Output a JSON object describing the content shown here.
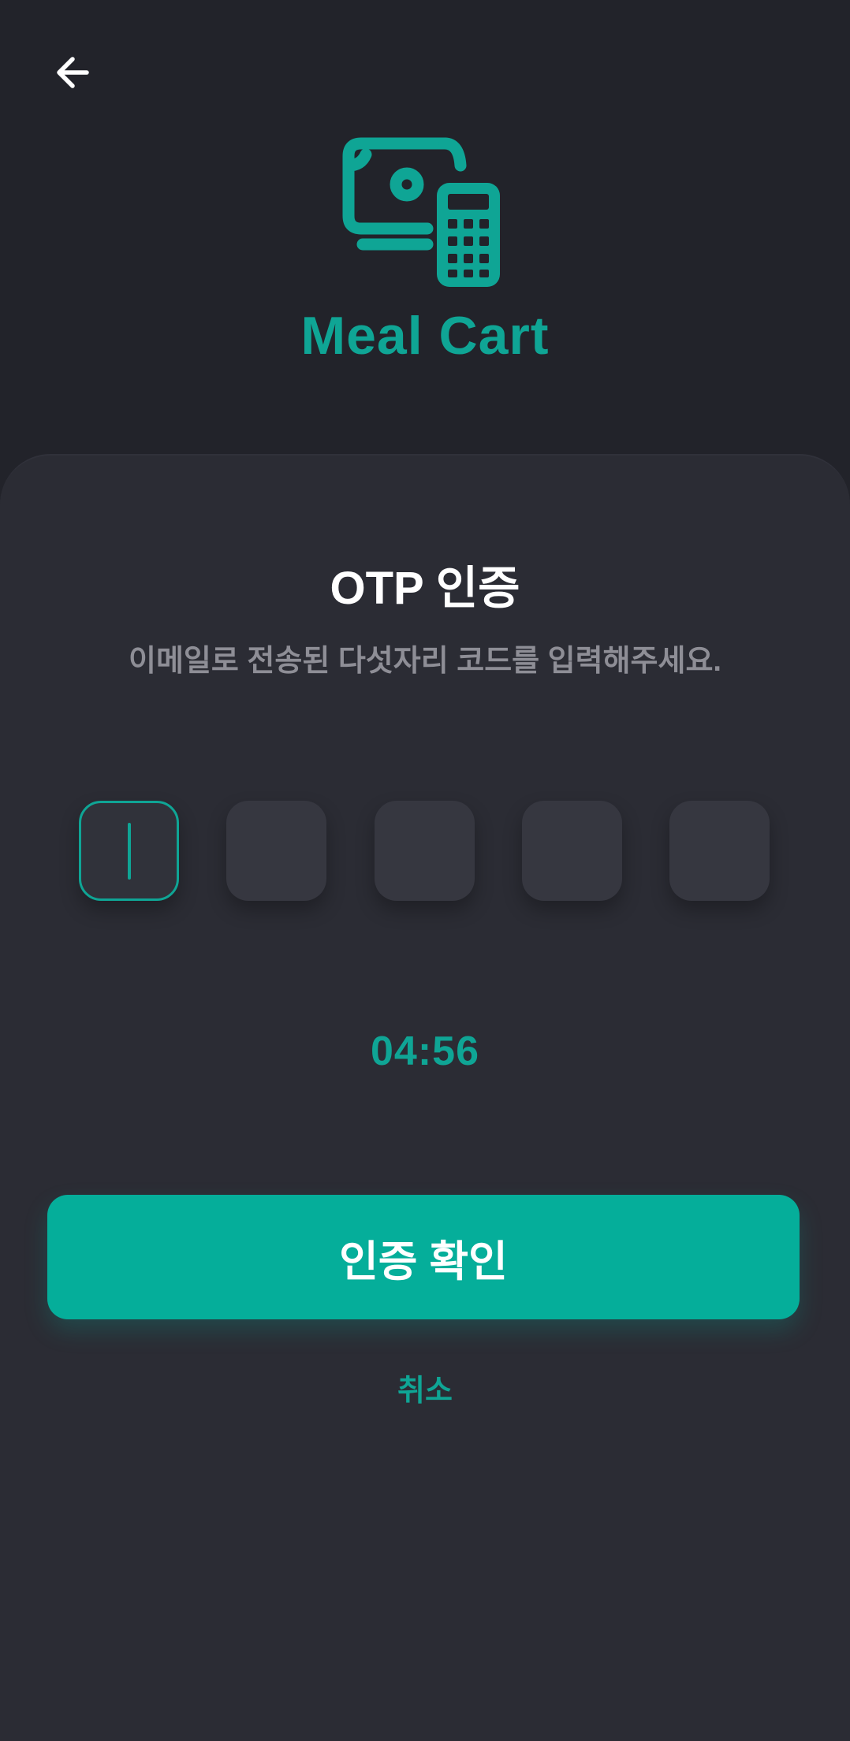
{
  "header": {
    "back_icon": "arrow-left-icon"
  },
  "brand": {
    "logo_icon": "cash-calculator-icon",
    "name": "Meal Cart",
    "color": "#0fa595"
  },
  "otp": {
    "title": "OTP 인증",
    "subtitle": "이메일로 전송된 다섯자리 코드를 입력해주세요.",
    "digits": [
      "",
      "",
      "",
      "",
      ""
    ],
    "active_index": 0,
    "timer": "04:56"
  },
  "actions": {
    "confirm_label": "인증 확인",
    "cancel_label": "취소"
  },
  "colors": {
    "background": "#22232a",
    "card": "#2b2c34",
    "accent": "#05ae9a",
    "input": "#363740",
    "subtitle": "#8e8e96"
  }
}
